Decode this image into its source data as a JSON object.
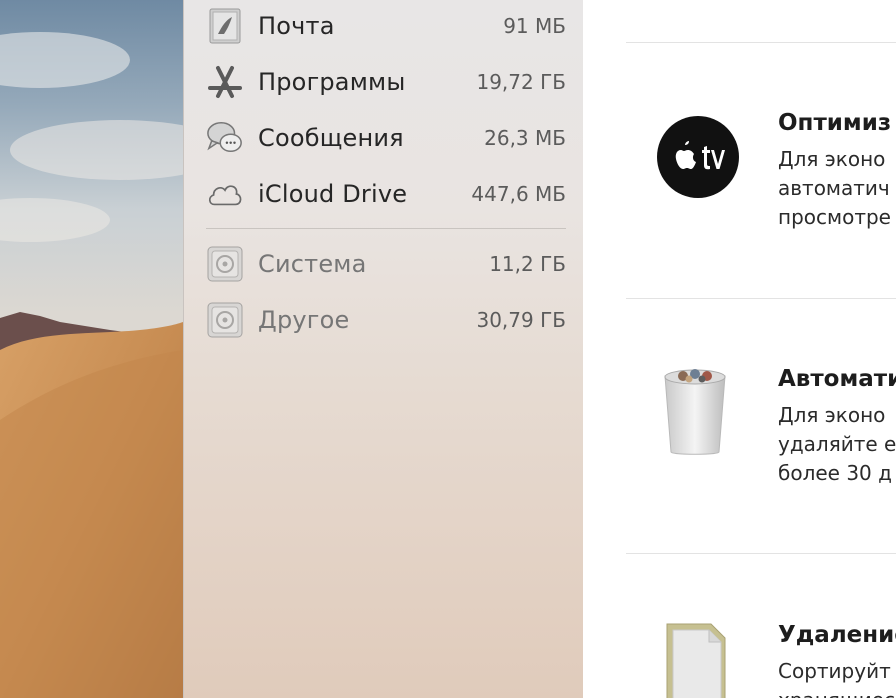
{
  "sidebar": {
    "items": [
      {
        "label": "Почта",
        "size": "91 МБ",
        "icon": "mail-stamp-icon"
      },
      {
        "label": "Программы",
        "size": "19,72 ГБ",
        "icon": "app-store-icon"
      },
      {
        "label": "Сообщения",
        "size": "26,3 МБ",
        "icon": "messages-icon"
      },
      {
        "label": "iCloud Drive",
        "size": "447,6 МБ",
        "icon": "icloud-icon"
      },
      {
        "label": "Система",
        "size": "11,2 ГБ",
        "icon": "system-disk-icon"
      },
      {
        "label": "Другое",
        "size": "30,79 ГБ",
        "icon": "other-disk-icon"
      }
    ]
  },
  "recommendations": [
    {
      "title": "Оптимиз",
      "lines": [
        "Для эконо",
        "автоматич",
        "просмотре"
      ],
      "icon": "apple-tv-icon"
    },
    {
      "title": "Автомати",
      "lines": [
        "Для эконо",
        "удаляйте е",
        "более 30 д"
      ],
      "icon": "trash-icon"
    },
    {
      "title": "Удаление",
      "lines": [
        "Сортируйт",
        "хранящиес"
      ],
      "icon": "document-icon"
    }
  ]
}
